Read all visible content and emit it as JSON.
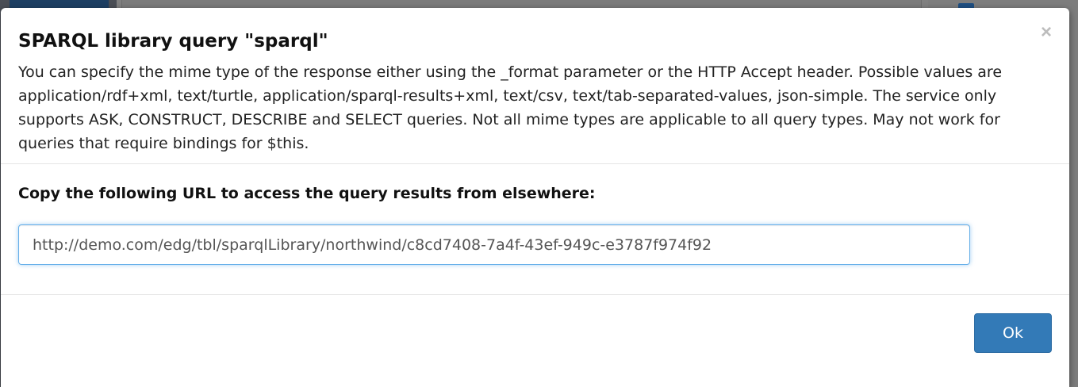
{
  "modal": {
    "title": "SPARQL library query \"sparql\"",
    "close_symbol": "×",
    "description": "You can specify the mime type of the response either using the _format parameter or the HTTP Accept header. Possible values are application/rdf+xml, text/turtle, application/sparql-results+xml, text/csv, text/tab-separated-values, json-simple. The service only supports ASK, CONSTRUCT, DESCRIBE and SELECT queries. Not all mime types are applicable to all query types. May not work for queries that require bindings for $this.",
    "url_label": "Copy the following URL to access the query results from elsewhere:",
    "url_value": "http://demo.com/edg/tbl/sparqlLibrary/northwind/c8cd7408-7a4f-43ef-949c-e3787f974f92",
    "ok_label": "Ok",
    "icons": {
      "close": "close-icon"
    }
  },
  "colors": {
    "primary_button": "#337ab7",
    "input_focus_border": "#66afe9",
    "backdrop": "#808080"
  }
}
